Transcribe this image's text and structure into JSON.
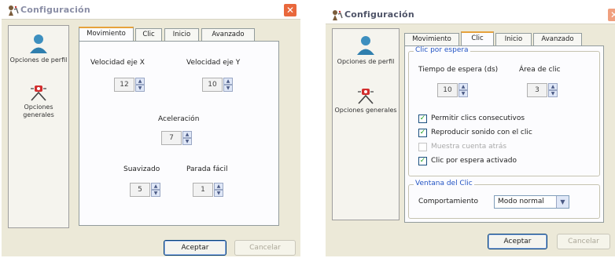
{
  "left_window": {
    "title": "Configuración",
    "close": "✕",
    "nav": [
      {
        "label": "Opciones de perfil",
        "icon": "profile-icon"
      },
      {
        "label": "Opciones generales",
        "icon": "general-options-icon"
      }
    ],
    "tabs": [
      "Movimiento",
      "Clic",
      "Inicio",
      "Avanzado"
    ],
    "active_tab": "Movimiento",
    "fields": {
      "velocidad_x": {
        "label": "Velocidad eje X",
        "value": "12"
      },
      "velocidad_y": {
        "label": "Velocidad eje Y",
        "value": "10"
      },
      "aceleracion": {
        "label": "Aceleración",
        "value": "7"
      },
      "suavizado": {
        "label": "Suavizado",
        "value": "5"
      },
      "parada_facil": {
        "label": "Parada fácil",
        "value": "1"
      }
    },
    "buttons": {
      "accept": "Aceptar",
      "cancel": "Cancelar"
    }
  },
  "right_window": {
    "title": "Configuración",
    "close": "✕",
    "nav": [
      {
        "label": "Opciones de perfil",
        "icon": "profile-icon"
      },
      {
        "label": "Opciones generales",
        "icon": "general-options-icon"
      }
    ],
    "tabs": [
      "Movimiento",
      "Clic",
      "Inicio",
      "Avanzado"
    ],
    "active_tab": "Clic",
    "group_dwell": {
      "title": "Clic por espera",
      "tiempo": {
        "label": "Tiempo de espera (ds)",
        "value": "10"
      },
      "area": {
        "label": "Área de clic",
        "value": "3"
      },
      "checkboxes": [
        {
          "label": "Permitir clics consecutivos",
          "checked": true,
          "enabled": true
        },
        {
          "label": "Reproducir sonido con el clic",
          "checked": true,
          "enabled": true
        },
        {
          "label": "Muestra cuenta atrás",
          "checked": false,
          "enabled": false
        },
        {
          "label": "Clic por espera activado",
          "checked": true,
          "enabled": true
        }
      ]
    },
    "group_window": {
      "title": "Ventana del Clic",
      "behavior_label": "Comportamiento",
      "behavior_value": "Modo normal"
    },
    "buttons": {
      "accept": "Aceptar",
      "cancel": "Cancelar"
    }
  },
  "colors": {
    "accent_tab": "#e6a23c",
    "group_title": "#2455c4",
    "close": "#e9683c",
    "check": "#21a121"
  }
}
